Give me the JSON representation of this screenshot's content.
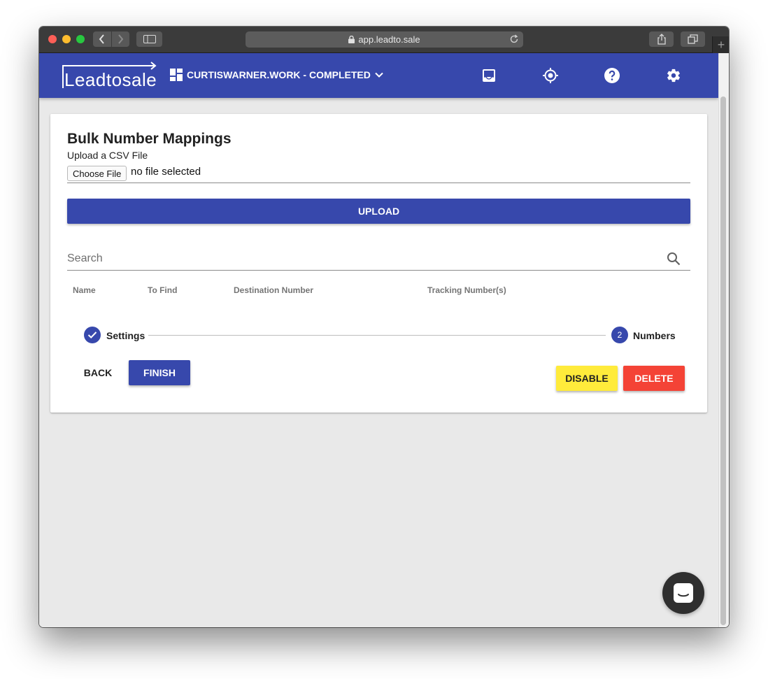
{
  "browser": {
    "url": "app.leadto.sale",
    "icons": [
      "back-icon",
      "forward-icon",
      "sidebar-icon",
      "lock-icon",
      "reload-icon",
      "share-icon",
      "tabs-icon",
      "new-tab-icon"
    ]
  },
  "app": {
    "logo_text": "Leadtosale",
    "project_name": "CURTISWARNER.WORK - COMPLETED",
    "colors": {
      "primary": "#3748ac",
      "disable": "#ffeb3b",
      "delete": "#f44336",
      "background": "#e9e9e9"
    },
    "appbar_icons": [
      "inbox-icon",
      "target-icon",
      "help-icon",
      "settings-icon"
    ]
  },
  "card": {
    "title": "Bulk Number Mappings",
    "upload_label": "Upload a CSV File",
    "choose_file_label": "Choose File",
    "file_status": "no file selected",
    "upload_button": "UPLOAD",
    "search_placeholder": "Search",
    "table": {
      "columns": [
        "Name",
        "To Find",
        "Destination Number",
        "Tracking Number(s)"
      ],
      "rows": []
    },
    "stepper": {
      "steps": [
        {
          "label": "Settings",
          "state": "completed",
          "icon": "check-icon"
        },
        {
          "label": "Numbers",
          "state": "active",
          "number": "2"
        }
      ]
    },
    "buttons": {
      "back": "BACK",
      "finish": "FINISH",
      "disable": "DISABLE",
      "delete": "DELETE"
    }
  },
  "chat_launcher_icon": "chat-icon"
}
